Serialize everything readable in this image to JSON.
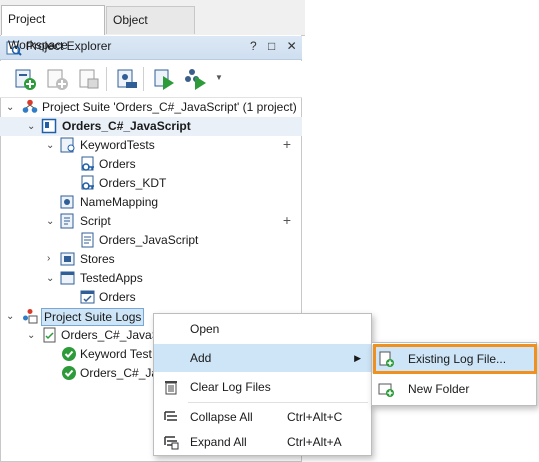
{
  "tabs": {
    "project_workspace": "Project Workspace",
    "object_browser": "Object Browser"
  },
  "panel": {
    "title": "Project Explorer",
    "controls": "? □ ✕"
  },
  "tree": {
    "suite": "Project Suite 'Orders_C#_JavaScript' (1 project)",
    "project": "Orders_C#_JavaScript",
    "keyword_tests": "KeywordTests",
    "orders": "Orders",
    "orders_kdt": "Orders_KDT",
    "namemapping": "NameMapping",
    "script": "Script",
    "orders_js": "Orders_JavaScript",
    "stores": "Stores",
    "tested_apps": "TestedApps",
    "orders_app": "Orders",
    "suite_logs": "Project Suite Logs",
    "log_project": "Orders_C#_JavaScr",
    "log_kwt": "Keyword Test L",
    "log_orders": "Orders_C#_Jav"
  },
  "menu": {
    "open": "Open",
    "add": "Add",
    "clear": "Clear Log Files",
    "collapse": "Collapse All",
    "collapse_sc": "Ctrl+Alt+C",
    "expand": "Expand All",
    "expand_sc": "Ctrl+Alt+A"
  },
  "submenu": {
    "existing": "Existing Log File...",
    "new_folder": "New Folder"
  },
  "colors": {
    "highlight": "#cde5f7",
    "orange_box": "#f0901e",
    "panel_header": "#dce8f5"
  }
}
